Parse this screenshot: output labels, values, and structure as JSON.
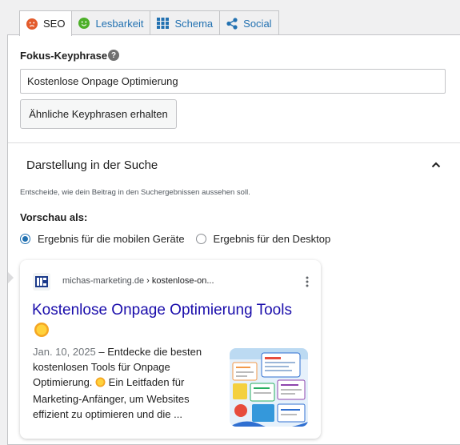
{
  "tabs": [
    {
      "label": "SEO",
      "icon": "sad-face-icon"
    },
    {
      "label": "Lesbarkeit",
      "icon": "smile-face-icon"
    },
    {
      "label": "Schema",
      "icon": "grid-icon"
    },
    {
      "label": "Social",
      "icon": "share-icon"
    }
  ],
  "keyphrase": {
    "label": "Fokus-Keyphrase",
    "help_glyph": "?",
    "value": "Kostenlose Onpage Optimierung",
    "button": "Ähnliche Keyphrasen erhalten"
  },
  "search_section": {
    "title": "Darstellung in der Suche",
    "hint": "Entscheide, wie dein Beitrag in den Suchergebnissen aussehen soll.",
    "preview_label": "Vorschau als:",
    "options": [
      "Ergebnis für die mobilen Geräte",
      "Ergebnis für den Desktop"
    ],
    "selected": 0
  },
  "preview": {
    "domain": "michas-marketing.de",
    "path": " › kostenlose-on...",
    "title": "Kostenlose Onpage Optimierung Tools",
    "date": "Jan. 10, 2025",
    "separator": " – ",
    "desc_1": "Entdecke die besten kostenlosen Tools für Onpage Optimierung.",
    "desc_2": " Ein Leitfaden für Marketing-Anfänger, um Websites effizient zu optimieren und die ..."
  },
  "colors": {
    "accent": "#2271b1",
    "link_title": "#1a0dab",
    "seo_face": "#e35b2c",
    "readability_face": "#4caf28"
  }
}
